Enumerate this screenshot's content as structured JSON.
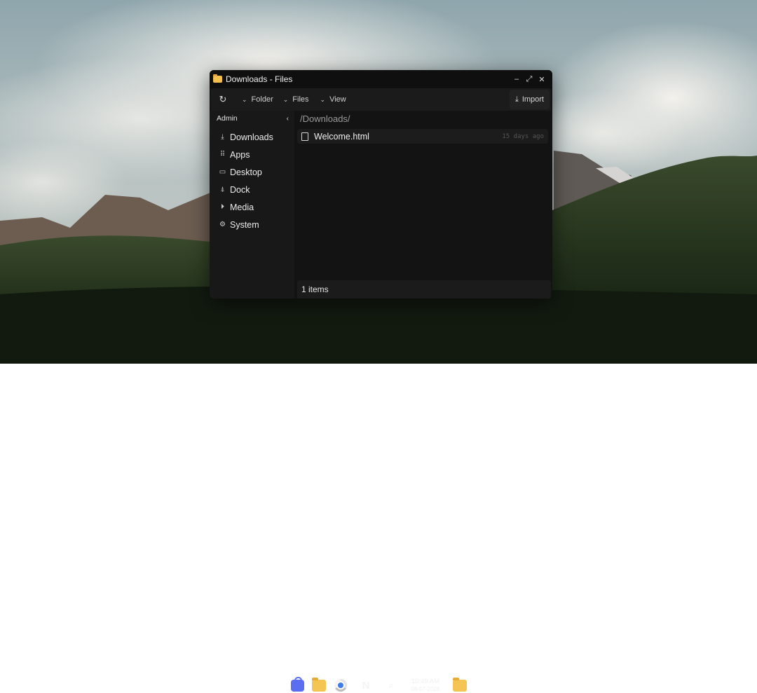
{
  "window": {
    "title": "Downloads - Files",
    "minimize_label": "–",
    "maximize_label": "⤢",
    "close_label": "✕"
  },
  "toolbar": {
    "refresh_icon": "refresh-icon",
    "folder_label": "Folder",
    "files_label": "Files",
    "view_label": "View",
    "import_label": "Import"
  },
  "sidebar": {
    "header": "Admin",
    "items": [
      {
        "label": "Downloads",
        "icon": "download-icon"
      },
      {
        "label": "Apps",
        "icon": "grid-icon"
      },
      {
        "label": "Desktop",
        "icon": "monitor-icon"
      },
      {
        "label": "Dock",
        "icon": "rocket-icon"
      },
      {
        "label": "Media",
        "icon": "play-icon"
      },
      {
        "label": "System",
        "icon": "gear-icon"
      }
    ]
  },
  "main": {
    "path": "/Downloads/",
    "files": [
      {
        "name": "Welcome.html",
        "modified": "15 days ago"
      }
    ],
    "status": "1 items"
  },
  "dock": {
    "time": "10:49 AM",
    "date": "08-07-2026",
    "app_n_label": "N"
  },
  "colors": {
    "window_bg": "#131313",
    "folder_yellow": "#f4c552",
    "store_blue": "#5b6df0"
  }
}
